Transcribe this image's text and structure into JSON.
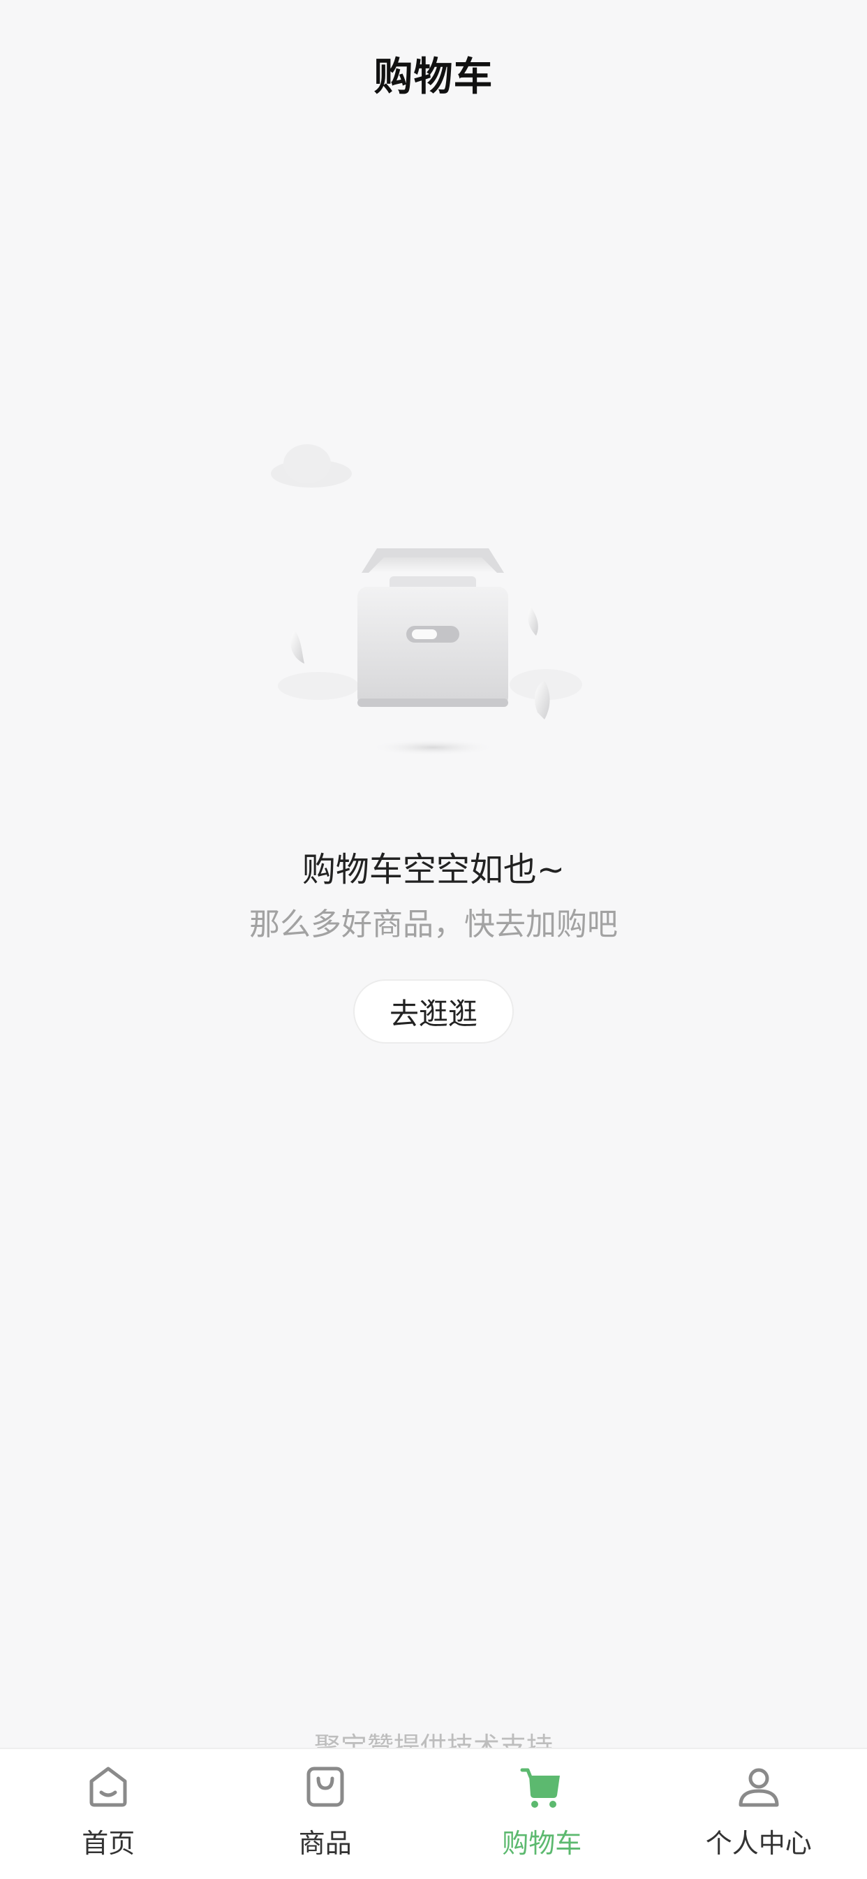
{
  "header": {
    "title": "购物车"
  },
  "empty_state": {
    "illustration": "empty-box-illustration",
    "title": "购物车空空如也~",
    "subtitle": "那么多好商品，快去加购吧",
    "button_label": "去逛逛"
  },
  "footer": {
    "note": "聚宝赞提供技术支持"
  },
  "tabbar": {
    "active_color": "#5cb96f",
    "items": [
      {
        "label": "首页",
        "icon": "home-icon"
      },
      {
        "label": "商品",
        "icon": "shopping-bag-icon"
      },
      {
        "label": "购物车",
        "icon": "cart-icon",
        "active": true
      },
      {
        "label": "个人中心",
        "icon": "user-icon"
      }
    ]
  }
}
